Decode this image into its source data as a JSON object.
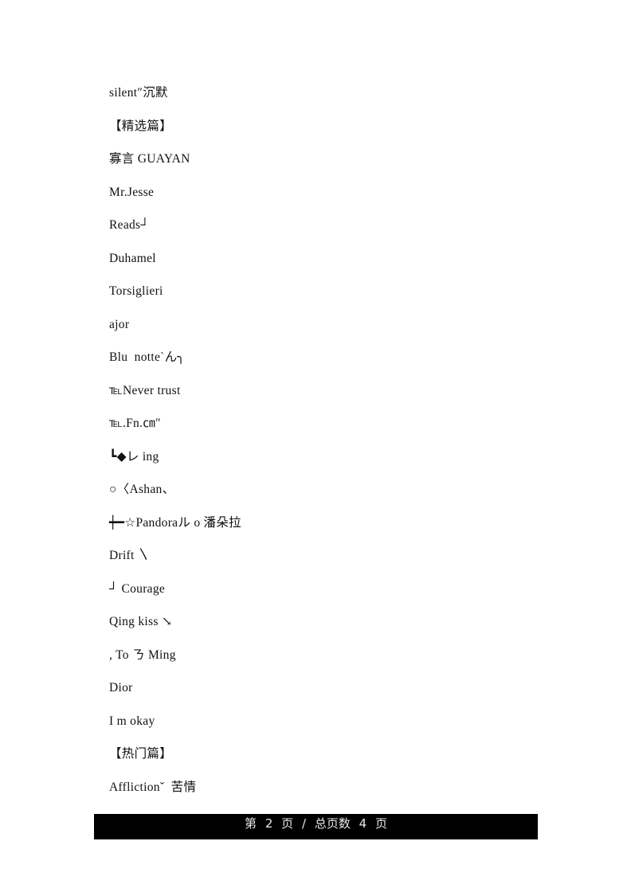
{
  "document": {
    "lines": [
      {
        "text": "silent″沉默"
      },
      {
        "text": "【精选篇】"
      },
      {
        "text": "寡言 GUAYAN"
      },
      {
        "text": "Mr.Jesse"
      },
      {
        "text": "Reads┘"
      },
      {
        "text": "Duhamel"
      },
      {
        "text": "Torsiglieri"
      },
      {
        "text": "ajor"
      },
      {
        "text": "Blu  notteˋん╮"
      },
      {
        "text": "℡Never trust"
      },
      {
        "text": "℡.Fn.㎝″"
      },
      {
        "text": "┗◆レ ing"
      },
      {
        "text": "○〈Ashan、"
      },
      {
        "text": "┿━☆Pandoraル o 潘朵拉"
      },
      {
        "text": "Drift 〵"
      },
      {
        "text": "┘ Courage"
      },
      {
        "text": "Qing kiss ↘"
      },
      {
        "text": ", To ㄋ Ming"
      },
      {
        "text": "Dior"
      },
      {
        "text": "I m okay"
      },
      {
        "text": "【热门篇】"
      },
      {
        "text": "Afflictionˇ  苦情"
      }
    ]
  },
  "footer": {
    "page_prefix": "第",
    "current_page": "2",
    "page_word": "页",
    "separator": "/",
    "total_label": "总页数",
    "total_pages": "4",
    "page_word_2": "页"
  }
}
